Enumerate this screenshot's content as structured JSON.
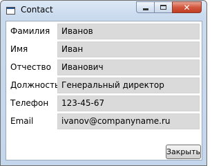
{
  "window": {
    "title": "Contact",
    "icon": "app-window-icon",
    "controls": {
      "minimize_icon": "minimize-icon",
      "maximize_icon": "maximize-icon",
      "close_icon": "close-icon",
      "close_glyph": "✕"
    }
  },
  "form": {
    "fields": [
      {
        "label": "Фамилия",
        "value": "Иванов"
      },
      {
        "label": "Имя",
        "value": "Иван"
      },
      {
        "label": "Отчество",
        "value": "Иванович"
      },
      {
        "label": "Должность",
        "value": "Генеральный директор"
      },
      {
        "label": "Телефон",
        "value": "123-45-67"
      },
      {
        "label": "Email",
        "value": "ivanov@companyname.ru"
      }
    ]
  },
  "footer": {
    "close_label": "Закрыть"
  },
  "colors": {
    "title_gradient_top": "#dce8f5",
    "field_background": "#dadada",
    "close_button_red": "#c13c22"
  }
}
